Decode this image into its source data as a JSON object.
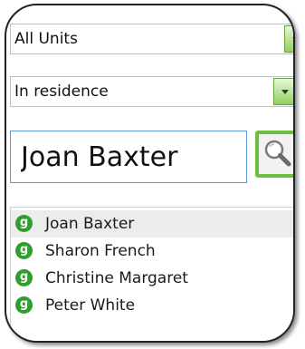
{
  "filters": {
    "units": {
      "value": "All Units"
    },
    "status": {
      "value": "In residence"
    }
  },
  "search": {
    "value": "Joan Baxter"
  },
  "results": [
    {
      "status_glyph": "g",
      "name": "Joan Baxter",
      "selected": true
    },
    {
      "status_glyph": "g",
      "name": "Sharon French",
      "selected": false
    },
    {
      "status_glyph": "g",
      "name": "Christine Margaret",
      "selected": false
    },
    {
      "status_glyph": "g",
      "name": "Peter White",
      "selected": false
    }
  ],
  "colors": {
    "accent_green": "#6fbe3f",
    "status_green": "#2e9e2e",
    "selected_row": "#ececec",
    "input_focus_border": "#5b9bd5"
  },
  "icons": {
    "search_button": "magnifier-icon",
    "dropdown": "chevron-down-icon",
    "resident_status": "status-badge-icon"
  }
}
